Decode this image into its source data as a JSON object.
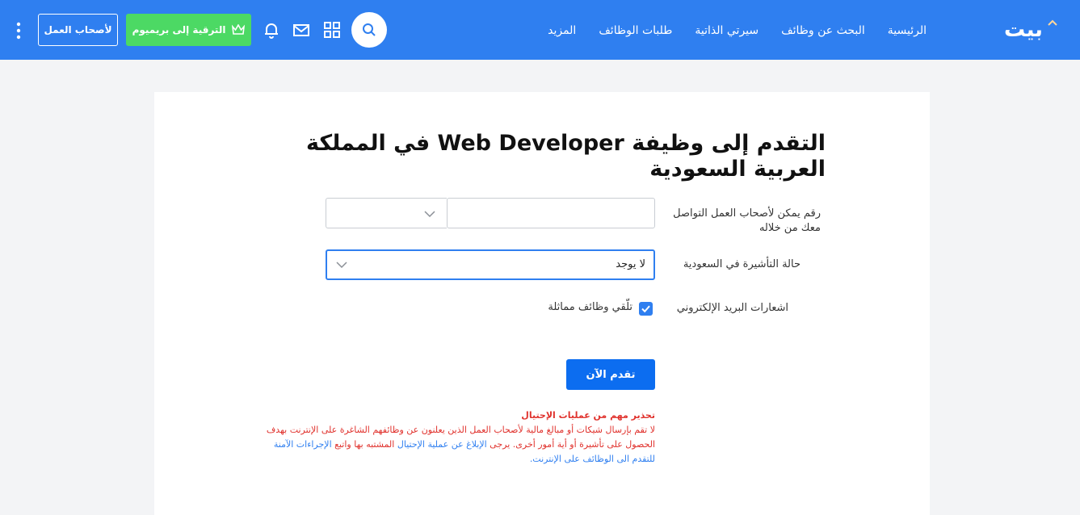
{
  "header": {
    "logo": "بيت",
    "nav": [
      "الرئيسية",
      "البحث عن وظائف",
      "سيرتي الذاتية",
      "طلبات الوظائف",
      "المزيد"
    ],
    "premium_label": "الترقية إلى بريميوم",
    "employers_label": "لأصحاب العمل"
  },
  "form": {
    "title": "التقدم إلى وظيفة Web Developer في المملكة العربية السعودية",
    "phone_label": "رقم يمكن لأصحاب العمل التواصل معك من خلاله",
    "visa_label": "حالة التأشيرة في السعودية",
    "visa_value": "لا يوجد",
    "email_label": "اشعارات البريد الإلكتروني",
    "similar_jobs_label": "تلّقي وظائف مماثلة",
    "similar_jobs_checked": true,
    "apply_label": "تقدم الآن"
  },
  "warning": {
    "title": "تحذير مهم من عمليات الإحتيال",
    "text1": "لا تقم بإرسال شيكات أو مبالغ مالية لأصحاب العمل الذين يعلنون عن وظائفهم الشاغرة على الإنترنت بهدف الحصول على تأشيرة أو أية أمور أخرى. يرجى ",
    "link1": "الإبلاغ عن عملية الإحتيال",
    "text2": " المشتبه بها واتبع ",
    "link2": "الإجراءات الآمنة للتقدم الى الوظائف على الإنترنت."
  },
  "colors": {
    "brand": "#2f7ff0",
    "premium": "#4cd964",
    "warning": "#e0312c"
  }
}
